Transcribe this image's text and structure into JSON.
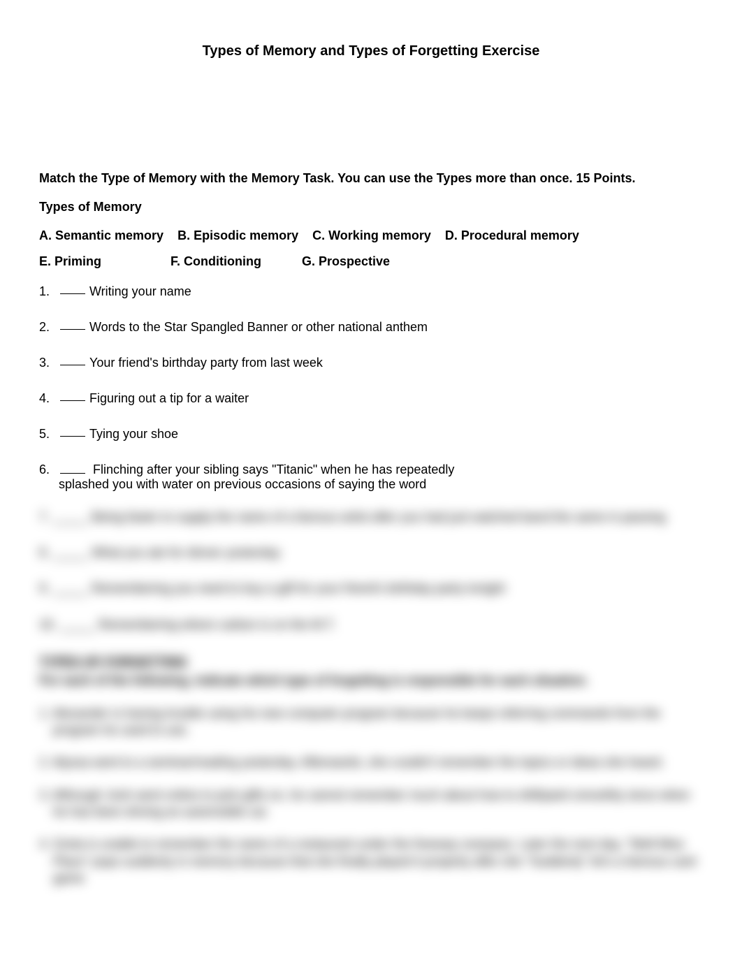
{
  "title": "Types of Memory and Types of Forgetting Exercise",
  "instructions": "Match the Type of Memory with the Memory Task. You can use the Types more than once. 15 Points.",
  "types_heading": "Types of Memory",
  "types": {
    "A": "A. Semantic memory",
    "B": "B. Episodic memory",
    "C": "C. Working memory",
    "D": "D. Procedural memory",
    "E": "E. Priming",
    "F": "F. Conditioning",
    "G": "G. Prospective"
  },
  "questions": [
    {
      "num": "1.",
      "text": "Writing your name"
    },
    {
      "num": "2.",
      "text": "Words to the Star Spangled Banner or other national anthem"
    },
    {
      "num": "3.",
      "text": "Your friend's birthday party from last week"
    },
    {
      "num": "4.",
      "text": "Figuring out a tip for a waiter"
    },
    {
      "num": "5.",
      "text": "Tying your shoe"
    },
    {
      "num": "6.",
      "text": "Flinching after your sibling says \"Titanic\" when he has repeatedly",
      "line2": "splashed you with water on previous occasions of saying the word"
    }
  ],
  "blurred": {
    "q7": "7. _____ Being faster to supply the name of a famous artist after you had just watched band the same in passing",
    "q8": "8. _____ What you ate for dinner yesterday",
    "q9": "9. _____ Remembering you need to buy a gift for your friend's birthday party tonight",
    "q10": "10. _____ Remembering where carbon is on the M.T.",
    "heading": "TYPES OF FORGETTING",
    "sub": "For each of the following, indicate which type of forgetting is responsible for each situation.",
    "p1": "1. Alexander is having trouble using his new computer program because he keeps referring commands from the program he used to use.",
    "p2": "2. Alyssa went to a seminar/reading yesterday. Afterwards, she couldn't remember the topics or ideas she heard.",
    "p3": "3. Although Josh went online to pick gifts on, he cannot remember much about how to drill/paint smoothly since when he has been driving an automobile car.",
    "p4": "4. Greta is unable to remember the name of a restaurant under the freeway overpass. Later the next day, \"Well Miss Place\" pops suddenly in memory because that she finally played it properly after she \"Suddenly\" let's a famous card game"
  }
}
